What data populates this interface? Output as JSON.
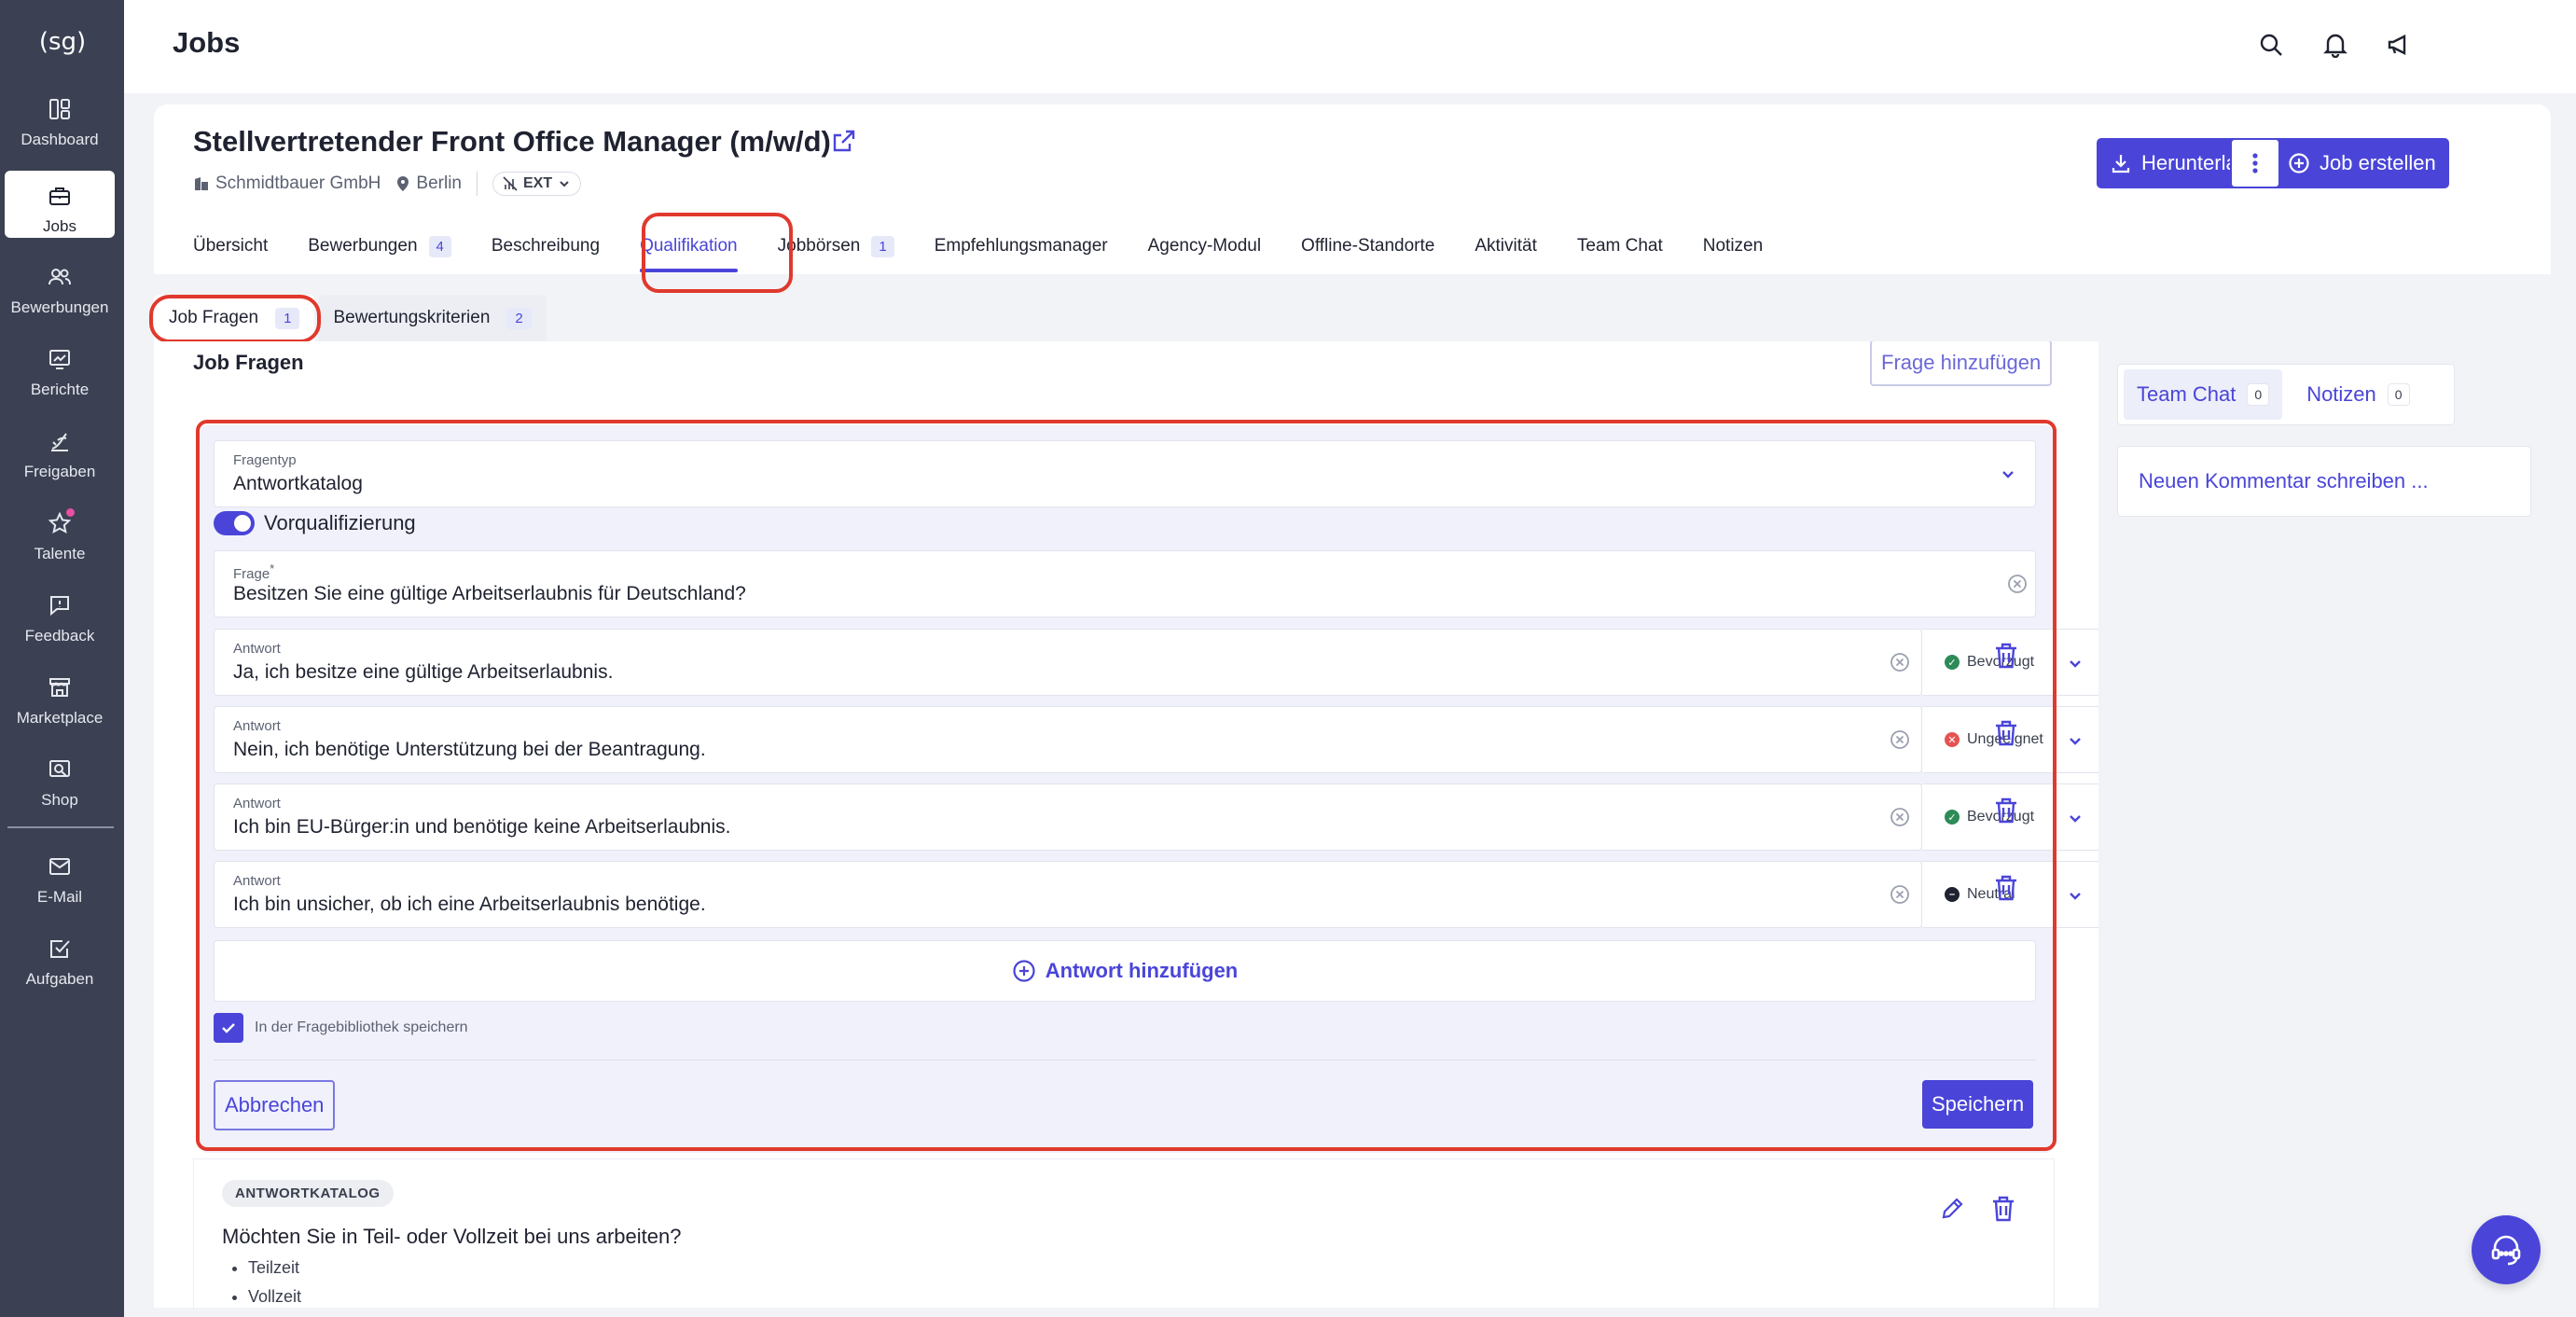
{
  "sidebar": {
    "logo": "(sg)",
    "items": [
      {
        "label": "Dashboard",
        "icon": "dashboard-icon"
      },
      {
        "label": "Jobs",
        "icon": "briefcase-icon"
      },
      {
        "label": "Bewerbungen",
        "icon": "users-icon"
      },
      {
        "label": "Berichte",
        "icon": "chart-icon"
      },
      {
        "label": "Freigaben",
        "icon": "approval-icon"
      },
      {
        "label": "Talente",
        "icon": "star-icon"
      },
      {
        "label": "Feedback",
        "icon": "feedback-icon"
      },
      {
        "label": "Marketplace",
        "icon": "store-icon"
      },
      {
        "label": "Shop",
        "icon": "shop-icon"
      },
      {
        "label": "E-Mail",
        "icon": "mail-icon"
      },
      {
        "label": "Aufgaben",
        "icon": "tasks-icon"
      }
    ],
    "active": "Jobs"
  },
  "topbar": {
    "title": "Jobs"
  },
  "job": {
    "title": "Stellvertretender Front Office Manager (m/w/d)",
    "company": "Schmidtbauer GmbH",
    "location": "Berlin",
    "badge": "EXT",
    "download_label": "Herunterladen",
    "create_label": "Job erstellen"
  },
  "tabs": [
    {
      "label": "Übersicht",
      "count": null
    },
    {
      "label": "Bewerbungen",
      "count": "4"
    },
    {
      "label": "Beschreibung",
      "count": null
    },
    {
      "label": "Qualifikation",
      "count": null
    },
    {
      "label": "Jobbörsen",
      "count": "1"
    },
    {
      "label": "Empfehlungsmanager",
      "count": null
    },
    {
      "label": "Agency-Modul",
      "count": null
    },
    {
      "label": "Offline-Standorte",
      "count": null
    },
    {
      "label": "Aktivität",
      "count": null
    },
    {
      "label": "Team Chat",
      "count": null
    },
    {
      "label": "Notizen",
      "count": null
    }
  ],
  "subtabs": [
    {
      "label": "Job Fragen",
      "count": "1"
    },
    {
      "label": "Bewertungskriterien",
      "count": "2"
    }
  ],
  "section": {
    "title": "Job Fragen",
    "add_question_label": "Frage hinzufügen"
  },
  "editor": {
    "type_label": "Fragentyp",
    "type_value": "Antwortkatalog",
    "prequal_label": "Vorqualifizierung",
    "question_label": "Frage",
    "question_required": "*",
    "question_value": "Besitzen Sie eine gültige Arbeitserlaubnis für Deutschland?",
    "answer_label": "Antwort",
    "answers": [
      {
        "text": "Ja, ich besitze eine gültige Arbeitserlaubnis.",
        "rating": "Bevorzugt",
        "color": "#2e8b57"
      },
      {
        "text": "Nein, ich benötige Unterstützung bei der Beantragung.",
        "rating": "Ungeeignet",
        "color": "#e55353"
      },
      {
        "text": "Ich bin EU-Bürger:in und benötige keine Arbeitserlaubnis.",
        "rating": "Bevorzugt",
        "color": "#2e8b57"
      },
      {
        "text": "Ich bin unsicher, ob ich eine Arbeitserlaubnis benötige.",
        "rating": "Neutral",
        "color": "#1f2230"
      }
    ],
    "add_answer_label": "Antwort hinzufügen",
    "save_library_label": "In der Fragebibliothek speichern",
    "cancel_label": "Abbrechen",
    "save_label": "Speichern"
  },
  "existing_question": {
    "badge": "ANTWORTKATALOG",
    "title": "Möchten Sie in Teil- oder Vollzeit bei uns arbeiten?",
    "options": [
      "Teilzeit",
      "Vollzeit"
    ]
  },
  "right_panel": {
    "tabs": [
      {
        "label": "Team Chat",
        "count": "0"
      },
      {
        "label": "Notizen",
        "count": "0"
      }
    ],
    "comment_placeholder": "Neuen Kommentar schreiben ..."
  },
  "colors": {
    "accent": "#4a45d8",
    "sidebar": "#3b4152",
    "highlight": "#e0392d"
  }
}
